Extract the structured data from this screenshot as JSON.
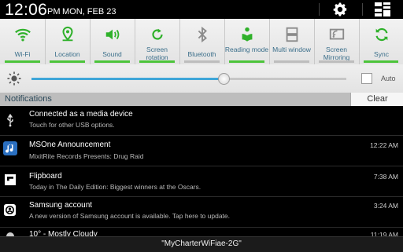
{
  "status_bar": {
    "time": "12:06",
    "ampm": "PM",
    "date": "MON, FEB 23",
    "icons": [
      "settings-gear-icon",
      "grid-view-icon"
    ]
  },
  "quick_settings": [
    {
      "label": "Wi-Fi",
      "icon": "wifi-icon",
      "on": true
    },
    {
      "label": "Location",
      "icon": "location-pin-icon",
      "on": true
    },
    {
      "label": "Sound",
      "icon": "speaker-icon",
      "on": true
    },
    {
      "label": "Screen rotation",
      "icon": "rotation-icon",
      "on": true
    },
    {
      "label": "Bluetooth",
      "icon": "bluetooth-icon",
      "on": false
    },
    {
      "label": "Reading mode",
      "icon": "reading-mode-icon",
      "on": true
    },
    {
      "label": "Multi window",
      "icon": "multi-window-icon",
      "on": false
    },
    {
      "label": "Screen Mirroring",
      "icon": "screen-mirroring-icon",
      "on": false
    },
    {
      "label": "Sync",
      "icon": "sync-icon",
      "on": true
    }
  ],
  "brightness": {
    "level_fraction": 0.61,
    "auto_label": "Auto",
    "auto_checked": false
  },
  "notifications": {
    "title": "Notifications",
    "clear_label": "Clear",
    "items": [
      {
        "icon": "usb-icon",
        "title": "Connected as a media device",
        "subtitle": "Touch for other USB options.",
        "time": ""
      },
      {
        "icon": "music-note-icon",
        "title": "MSOne Announcement",
        "subtitle": "MixitRite Records Presents: Drug Raid",
        "time": "12:22 AM"
      },
      {
        "icon": "flipboard-icon",
        "title": "Flipboard",
        "subtitle": "Today in The Daily Edition: Biggest winners at the Oscars.",
        "time": "7:38 AM"
      },
      {
        "icon": "samsung-account-icon",
        "title": "Samsung account",
        "subtitle": "A new version of Samsung account is available. Tap here to update.",
        "time": "3:24 AM"
      },
      {
        "icon": "weather-icon",
        "title": "10° - Mostly Cloudy",
        "subtitle": "",
        "time": "11:19 AM"
      }
    ]
  },
  "toast": "\"MyCharterWiFiae-2G\"",
  "colors": {
    "toggle_on": "#4cc43a",
    "toggle_icon": "#2fb12a",
    "brightness_fill": "#3fa6d8",
    "label_text": "#3a6e8a"
  }
}
